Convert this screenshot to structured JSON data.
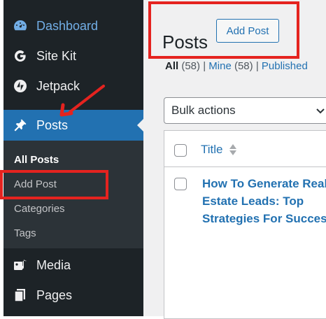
{
  "sidebar": {
    "items": [
      {
        "label": "Dashboard",
        "icon": "dashboard-icon"
      },
      {
        "label": "Site Kit",
        "icon": "site-kit-icon"
      },
      {
        "label": "Jetpack",
        "icon": "jetpack-icon"
      },
      {
        "label": "Posts",
        "icon": "pushpin-icon"
      },
      {
        "label": "Media",
        "icon": "media-icon"
      },
      {
        "label": "Pages",
        "icon": "pages-icon"
      }
    ],
    "submenu": [
      "All Posts",
      "Add Post",
      "Categories",
      "Tags"
    ]
  },
  "main": {
    "title": "Posts",
    "add_button": "Add Post",
    "views": [
      {
        "label": "All",
        "count": "(58)"
      },
      {
        "label": "Mine",
        "count": "(58)"
      },
      {
        "label": "Published"
      }
    ],
    "bulk_actions": "Bulk actions",
    "table": {
      "column_title": "Title",
      "rows": [
        {
          "title": "How To Generate Real Estate Leads: Top Strategies For Success"
        }
      ]
    }
  },
  "colors": {
    "sidebar_bg": "#1d2327",
    "active_blue": "#2271b1",
    "link_blue": "#2271b1",
    "highlight_red": "#e5231f"
  }
}
